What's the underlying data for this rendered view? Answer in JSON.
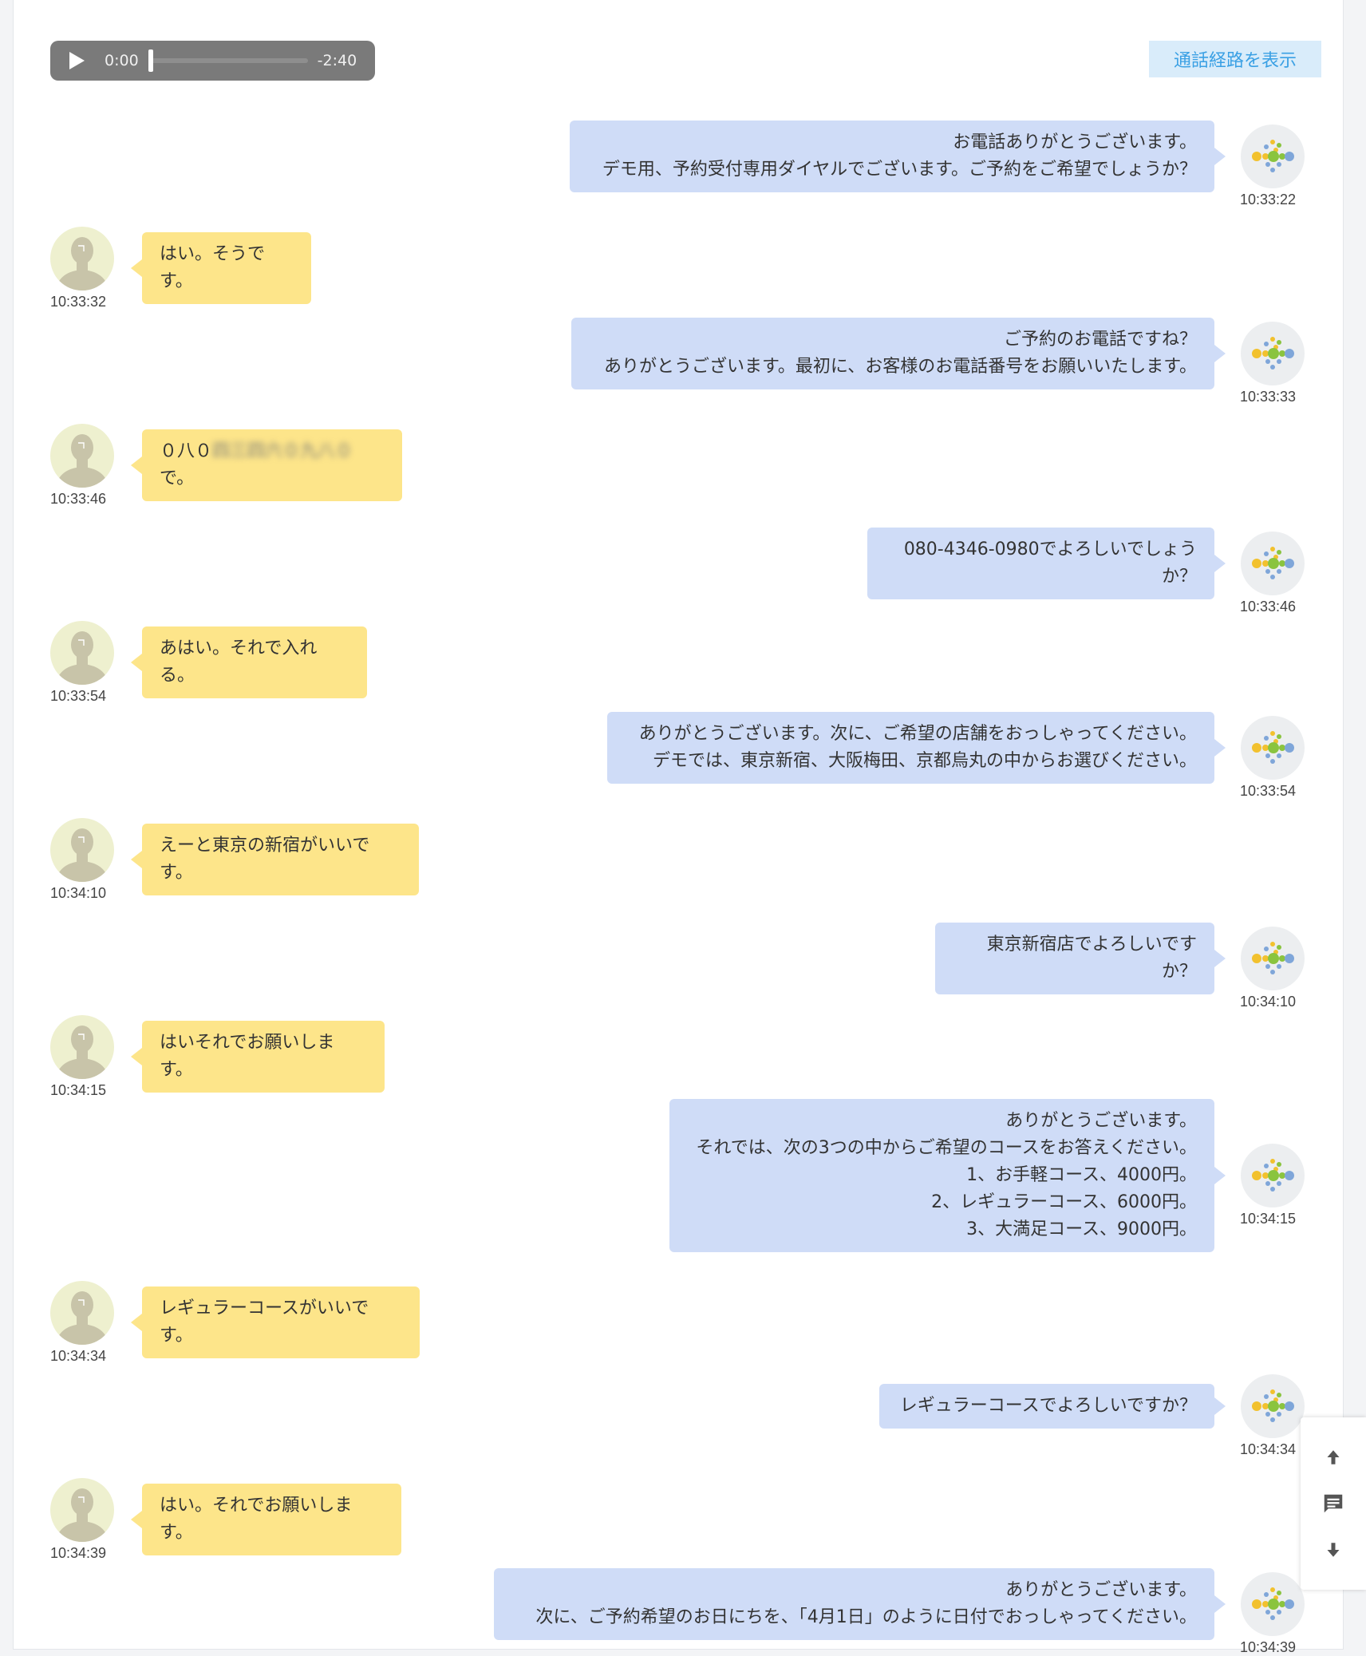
{
  "player": {
    "current_time": "0:00",
    "remaining_time": "-2:40",
    "progress": 0
  },
  "route_button": "通話経路を表示",
  "messages": [
    {
      "speaker": "bot",
      "text": "お電話ありがとうございます。\nデモ用、予約受付専用ダイヤルでございます。ご予約をご希望でしょうか？",
      "time": "10:33:22"
    },
    {
      "speaker": "user",
      "text": "はい。そうです。",
      "time": "10:33:32"
    },
    {
      "speaker": "bot",
      "text": "ご予約のお電話ですね？\nありがとうございます。最初に、お客様のお電話番号をお願いいたします。",
      "time": "10:33:33"
    },
    {
      "speaker": "user",
      "text": "０八０",
      "hidden": "四三四六０九八０",
      "suffix": "で。",
      "time": "10:33:46"
    },
    {
      "speaker": "bot",
      "text": "080-4346-0980でよろしいでしょうか？",
      "time": "10:33:46"
    },
    {
      "speaker": "user",
      "text": "あはい。それで入れる。",
      "time": "10:33:54"
    },
    {
      "speaker": "bot",
      "text": "ありがとうございます。次に、ご希望の店舗をおっしゃってください。\nデモでは、東京新宿、大阪梅田、京都烏丸の中からお選びください。",
      "time": "10:33:54"
    },
    {
      "speaker": "user",
      "text": "えーと東京の新宿がいいです。",
      "time": "10:34:10"
    },
    {
      "speaker": "bot",
      "text": "東京新宿店でよろしいですか？",
      "time": "10:34:10"
    },
    {
      "speaker": "user",
      "text": "はいそれでお願いします。",
      "time": "10:34:15"
    },
    {
      "speaker": "bot",
      "text": "ありがとうございます。\nそれでは、次の3つの中からご希望のコースをお答えください。\n1、お手軽コース、4000円。\n2、レギュラーコース、6000円。\n3、大満足コース、9000円。",
      "time": "10:34:15"
    },
    {
      "speaker": "user",
      "text": "レギュラーコースがいいです。",
      "time": "10:34:34"
    },
    {
      "speaker": "bot",
      "text": "レギュラーコースでよろしいですか？",
      "time": "10:34:34"
    },
    {
      "speaker": "user",
      "text": "はい。それでお願いします。",
      "time": "10:34:39"
    },
    {
      "speaker": "bot",
      "text": "ありがとうございます。\n次に、ご予約希望のお日にちを、「4月1日」のように日付でおっしゃってください。",
      "time": "10:34:39"
    }
  ],
  "icons": {
    "play": "play-icon",
    "scroll_up": "arrow-up-icon",
    "chat": "chat-icon",
    "scroll_down": "arrow-down-icon",
    "bot_avatar": "bot-logo-icon",
    "user_avatar": "user-silhouette-icon"
  },
  "colors": {
    "bot_bubble": "#cfdcf7",
    "user_bubble": "#fde58a",
    "route_button_bg": "#d9ecfa",
    "route_button_text": "#3aa0e4",
    "player_bg": "#7a7a7a"
  }
}
